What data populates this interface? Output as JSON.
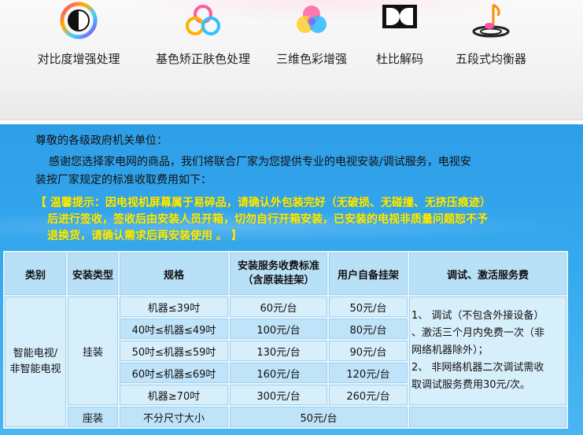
{
  "features": [
    {
      "label": "对比度增强处理",
      "icon": "contrast-icon"
    },
    {
      "label": "基色矫正肤色处理",
      "icon": "primary-colors-icon"
    },
    {
      "label": "三维色彩增强",
      "icon": "rgb-color-icon"
    },
    {
      "label": "杜比解码",
      "icon": "dolby-icon"
    },
    {
      "label": "五段式均衡器",
      "icon": "music-note-icon"
    }
  ],
  "notice": {
    "greeting": "尊敬的各级政府机关单位：",
    "intro_line1": "感谢您选择家电网的商品，我们将联合厂家为您提供专业的电视安装/调试服务，电视安",
    "intro_line2": "装按厂家规定的标准收取费用如下：",
    "warning_line1": "【 温馨提示：因电视机屏幕属于易碎品，请确认外包装完好（无破损、无碰撞、无挤压痕迹）",
    "warning_line2": "后进行签收，签收后由安装人员开箱，切勿自行开箱安装，已安装的电视非质量问题恕不予",
    "warning_line3": "退换货，请确认需求后再安装使用 。 】"
  },
  "table": {
    "headers": {
      "category": "类别",
      "install_type": "安装类型",
      "spec": "规格",
      "fee_line1": "安装服务收费标准",
      "fee_line2": "（含原装挂架）",
      "own_bracket": "用户自备挂架",
      "service": "调试、激活服务费"
    },
    "category": {
      "line1": "智能电视/",
      "line2": "非智能电视"
    },
    "wall_mount": "挂装",
    "rows": [
      {
        "spec": "机器≤39吋",
        "fee": "60元/台",
        "own": "50元/台"
      },
      {
        "spec": "40吋≤机器≤49吋",
        "fee": "100元/台",
        "own": "80元/台"
      },
      {
        "spec": "50吋≤机器≤59吋",
        "fee": "130元/台",
        "own": "90元/台"
      },
      {
        "spec": "60吋≤机器≤69吋",
        "fee": "160元/台",
        "own": "120元/台"
      },
      {
        "spec": "机器≥70吋",
        "fee": "300元/台",
        "own": "260元/台"
      }
    ],
    "service": {
      "line1": "1、 调试（不包含外接设备）",
      "line2": "、激活三个月内免费一次（非",
      "line3": "网络机器除外）；",
      "line4": "2、 非网络机器二次调试需收",
      "line5": "取调试服务费用30元/次。"
    },
    "seat": {
      "type": "座装",
      "spec": "不分尺寸大小",
      "fee": "50元/台"
    }
  }
}
